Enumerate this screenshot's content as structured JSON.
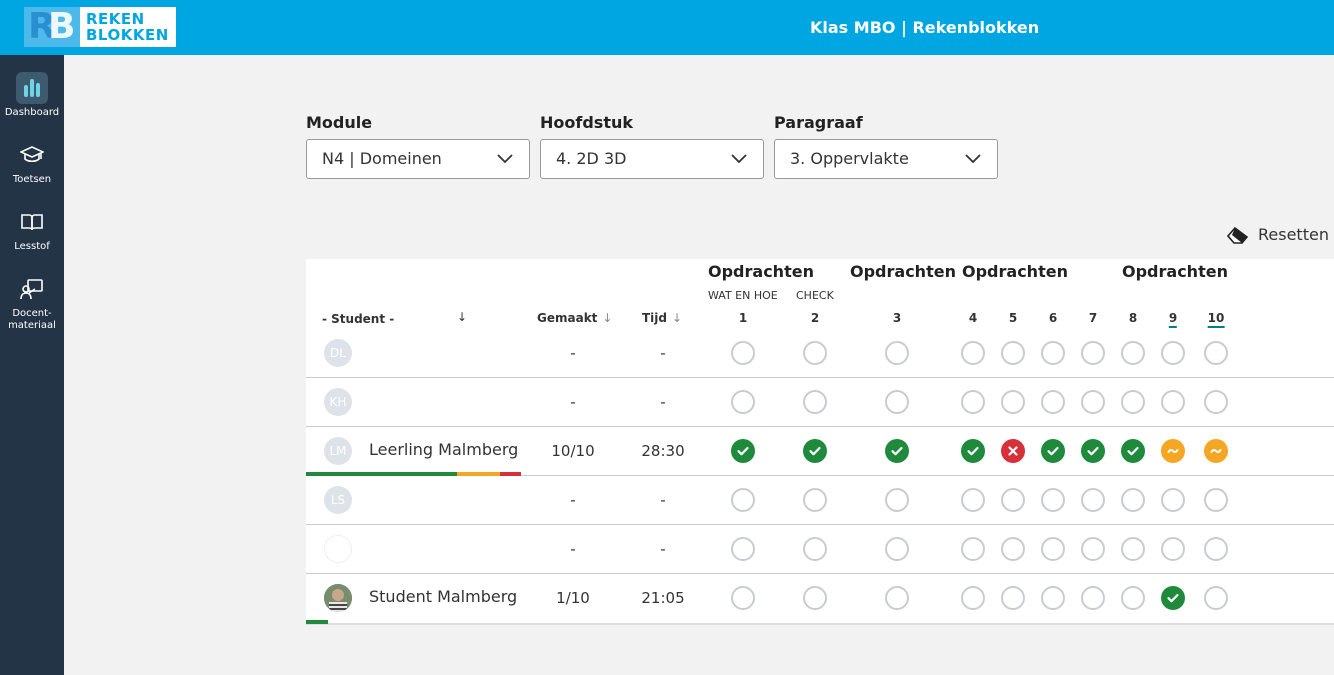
{
  "header": {
    "logo_line1": "REKEN",
    "logo_line2": "BLOKKEN",
    "title": "Klas MBO | Rekenblokken"
  },
  "sidebar": {
    "items": [
      {
        "label": "Dashboard",
        "icon": "bar-chart-icon",
        "active": true
      },
      {
        "label": "Toetsen",
        "icon": "graduation-cap-icon"
      },
      {
        "label": "Lesstof",
        "icon": "book-icon"
      },
      {
        "label_line1": "Docent-",
        "label_line2": "materiaal",
        "icon": "teacher-board-icon"
      }
    ]
  },
  "filters": {
    "module": {
      "label": "Module",
      "value": "N4 | Domeinen"
    },
    "hoofdstuk": {
      "label": "Hoofdstuk",
      "value": "4. 2D 3D"
    },
    "paragraaf": {
      "label": "Paragraaf",
      "value": "3. Oppervlakte"
    }
  },
  "reset_label": "Resetten",
  "table": {
    "group_title": "Opdrachten",
    "sub_labels": [
      "WAT EN HOE",
      "CHECK"
    ],
    "headers": {
      "student": "- Student -",
      "gemaakt": "Gemaakt",
      "tijd": "Tijd",
      "numbers": [
        "1",
        "2",
        "3",
        "4",
        "5",
        "6",
        "7",
        "8",
        "9",
        "10"
      ]
    },
    "rows": [
      {
        "initials": "DL",
        "name": "",
        "gemaakt": "-",
        "tijd": "-",
        "status": [
          "empty",
          "empty",
          "empty",
          "empty",
          "empty",
          "empty",
          "empty",
          "empty",
          "empty",
          "empty"
        ]
      },
      {
        "initials": "KH",
        "name": "",
        "gemaakt": "-",
        "tijd": "-",
        "status": [
          "empty",
          "empty",
          "empty",
          "empty",
          "empty",
          "empty",
          "empty",
          "empty",
          "empty",
          "empty"
        ]
      },
      {
        "initials": "LM",
        "name": "Leerling Malmberg",
        "gemaakt": "10/10",
        "tijd": "28:30",
        "status": [
          "ok",
          "ok",
          "ok",
          "ok",
          "err",
          "ok",
          "ok",
          "ok",
          "mid",
          "mid"
        ],
        "progress": [
          {
            "color": "#1f8a3c",
            "fraction": 0.7
          },
          {
            "color": "#f5a623",
            "fraction": 0.2
          },
          {
            "color": "#d6303a",
            "fraction": 0.1
          }
        ]
      },
      {
        "initials": "LS",
        "name": "",
        "gemaakt": "-",
        "tijd": "-",
        "status": [
          "empty",
          "empty",
          "empty",
          "empty",
          "empty",
          "empty",
          "empty",
          "empty",
          "empty",
          "empty"
        ]
      },
      {
        "initials": "",
        "name": "",
        "gemaakt": "-",
        "tijd": "-",
        "status": [
          "empty",
          "empty",
          "empty",
          "empty",
          "empty",
          "empty",
          "empty",
          "empty",
          "empty",
          "empty"
        ]
      },
      {
        "initials": "",
        "name": "Student Malmberg",
        "gemaakt": "1/10",
        "tijd": "21:05",
        "status": [
          "empty",
          "empty",
          "empty",
          "empty",
          "empty",
          "empty",
          "empty",
          "empty",
          "ok",
          "empty"
        ],
        "progress": [
          {
            "color": "#1f8a3c",
            "fraction": 0.1
          }
        ]
      }
    ]
  },
  "colors": {
    "header": "#00a6e2",
    "sidebar": "#243447",
    "ok": "#1f8a3c",
    "err": "#d6303a",
    "partial": "#f5a623"
  }
}
